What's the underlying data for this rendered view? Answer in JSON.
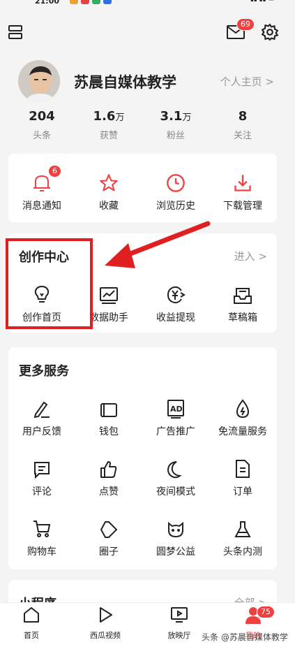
{
  "status": {
    "time": "21:00"
  },
  "header": {
    "mail_badge": "69"
  },
  "profile": {
    "name": "苏晨自媒体教学",
    "homepage_link": "个人主页 >",
    "stats": [
      {
        "num": "204",
        "unit": "",
        "label": "头条"
      },
      {
        "num": "1.6",
        "unit": "万",
        "label": "获赞"
      },
      {
        "num": "3.1",
        "unit": "万",
        "label": "粉丝"
      },
      {
        "num": "8",
        "unit": "",
        "label": "关注"
      }
    ]
  },
  "quick": {
    "items": [
      {
        "label": "消息通知",
        "icon": "bell-icon",
        "badge": "6"
      },
      {
        "label": "收藏",
        "icon": "star-icon"
      },
      {
        "label": "浏览历史",
        "icon": "clock-icon"
      },
      {
        "label": "下载管理",
        "icon": "download-icon"
      }
    ]
  },
  "creator": {
    "title": "创作中心",
    "enter": "进入 >",
    "items": [
      {
        "label": "创作首页",
        "icon": "bulb-icon"
      },
      {
        "label": "数据助手",
        "icon": "chart-icon"
      },
      {
        "label": "收益提现",
        "icon": "yuan-icon"
      },
      {
        "label": "草稿箱",
        "icon": "draft-box-icon"
      }
    ]
  },
  "more": {
    "title": "更多服务",
    "items": [
      {
        "label": "用户反馈",
        "icon": "edit-icon"
      },
      {
        "label": "钱包",
        "icon": "wallet-icon"
      },
      {
        "label": "广告推广",
        "icon": "ad-icon"
      },
      {
        "label": "免流量服务",
        "icon": "drop-icon"
      },
      {
        "label": "评论",
        "icon": "comment-icon"
      },
      {
        "label": "点赞",
        "icon": "thumb-up-icon"
      },
      {
        "label": "夜间模式",
        "icon": "moon-icon"
      },
      {
        "label": "订单",
        "icon": "order-icon"
      },
      {
        "label": "购物车",
        "icon": "cart-icon"
      },
      {
        "label": "圈子",
        "icon": "circle-icon"
      },
      {
        "label": "圆梦公益",
        "icon": "charity-icon"
      },
      {
        "label": "头条内测",
        "icon": "flask-icon"
      }
    ]
  },
  "mini": {
    "title": "小程序",
    "more": "全部 >"
  },
  "nav": {
    "tabs": [
      {
        "label": "首页",
        "icon": "home-icon"
      },
      {
        "label": "西瓜视频",
        "icon": "play-icon"
      },
      {
        "label": "放映厅",
        "icon": "tv-icon"
      },
      {
        "label": "我的",
        "icon": "user-icon",
        "badge": "75"
      }
    ]
  },
  "watermark": "头条 @苏晨自媒体教学",
  "colors": {
    "accent": "#f04142",
    "highlight": "#e02020"
  }
}
